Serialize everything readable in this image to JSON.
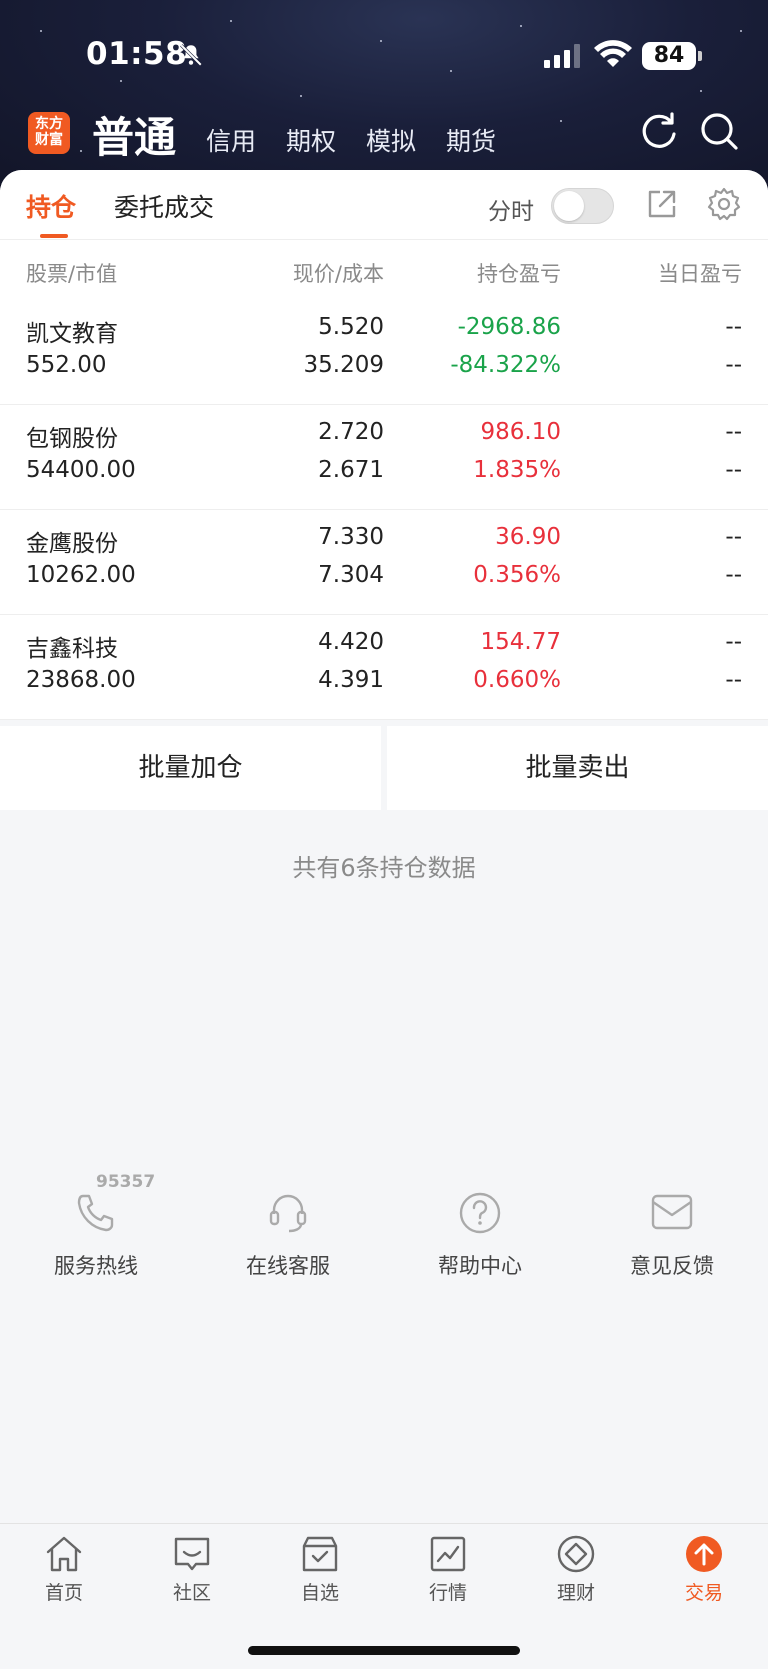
{
  "status_bar": {
    "time": "01:58",
    "battery": "84"
  },
  "header": {
    "logo_line1": "东方",
    "logo_line2": "财富",
    "title": "普通",
    "tabs": [
      "信用",
      "期权",
      "模拟",
      "期货"
    ]
  },
  "subtabs": {
    "holdings": "持仓",
    "orders": "委托成交",
    "fenshi_label": "分时"
  },
  "table_header": {
    "stock_mv": "股票/市值",
    "price_cost": "现价/成本",
    "pl": "持仓盈亏",
    "day_pl": "当日盈亏"
  },
  "holdings": [
    {
      "name": "凯文教育",
      "market_value": "552.00",
      "price": "5.520",
      "cost": "35.209",
      "pl": "-2968.86",
      "pl_pct": "-84.322%",
      "day_pl": "--",
      "day_pl_pct": "--",
      "color": "#1aa34a"
    },
    {
      "name": "包钢股份",
      "market_value": "54400.00",
      "price": "2.720",
      "cost": "2.671",
      "pl": "986.10",
      "pl_pct": "1.835%",
      "day_pl": "--",
      "day_pl_pct": "--",
      "color": "#e8303b"
    },
    {
      "name": "金鹰股份",
      "market_value": "10262.00",
      "price": "7.330",
      "cost": "7.304",
      "pl": "36.90",
      "pl_pct": "0.356%",
      "day_pl": "--",
      "day_pl_pct": "--",
      "color": "#e8303b"
    },
    {
      "name": "吉鑫科技",
      "market_value": "23868.00",
      "price": "4.420",
      "cost": "4.391",
      "pl": "154.77",
      "pl_pct": "0.660%",
      "day_pl": "--",
      "day_pl_pct": "--",
      "color": "#e8303b"
    }
  ],
  "batch": {
    "add": "批量加仓",
    "sell": "批量卖出"
  },
  "summary": "共有6条持仓数据",
  "service": {
    "hotline_number": "95357",
    "items": [
      "服务热线",
      "在线客服",
      "帮助中心",
      "意见反馈"
    ]
  },
  "tabbar": [
    "首页",
    "社区",
    "自选",
    "行情",
    "理财",
    "交易"
  ],
  "colors": {
    "accent": "#f05a22",
    "up": "#e8303b",
    "down": "#1aa34a"
  }
}
